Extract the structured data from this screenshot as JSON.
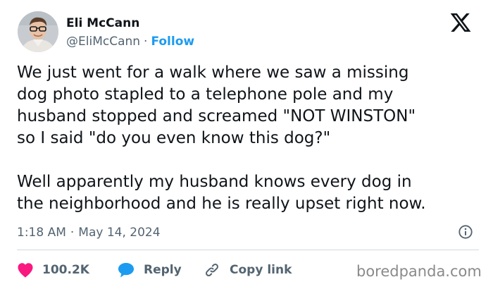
{
  "author": {
    "display_name": "Eli McCann",
    "handle": "@EliMcCann",
    "separator": "·",
    "follow_label": "Follow"
  },
  "tweet": {
    "text": "We just went for a walk where we saw a missing\ndog photo stapled to a telephone pole and my\nhusband stopped and screamed \"NOT WINSTON\"\nso I said \"do you even know this dog?\"\n\nWell apparently my husband knows every dog in\nthe neighborhood and he is really upset right now.",
    "time": "1:18 AM",
    "separator": "·",
    "date": "May 14, 2024"
  },
  "actions": {
    "like_count": "100.2K",
    "reply_label": "Reply",
    "copy_label": "Copy link"
  },
  "watermark": "boredpanda.com",
  "icons": {
    "logo": "x-logo-icon",
    "info": "info-icon",
    "like": "heart-icon",
    "reply": "speech-bubble-icon",
    "copy": "link-icon"
  },
  "colors": {
    "text": "#0f1419",
    "secondary": "#536471",
    "follow": "#1d9bf0",
    "heart": "#f91880",
    "reply_bubble": "#1d9bf0",
    "divider": "#cfd9de",
    "watermark": "#8a8a8a"
  }
}
